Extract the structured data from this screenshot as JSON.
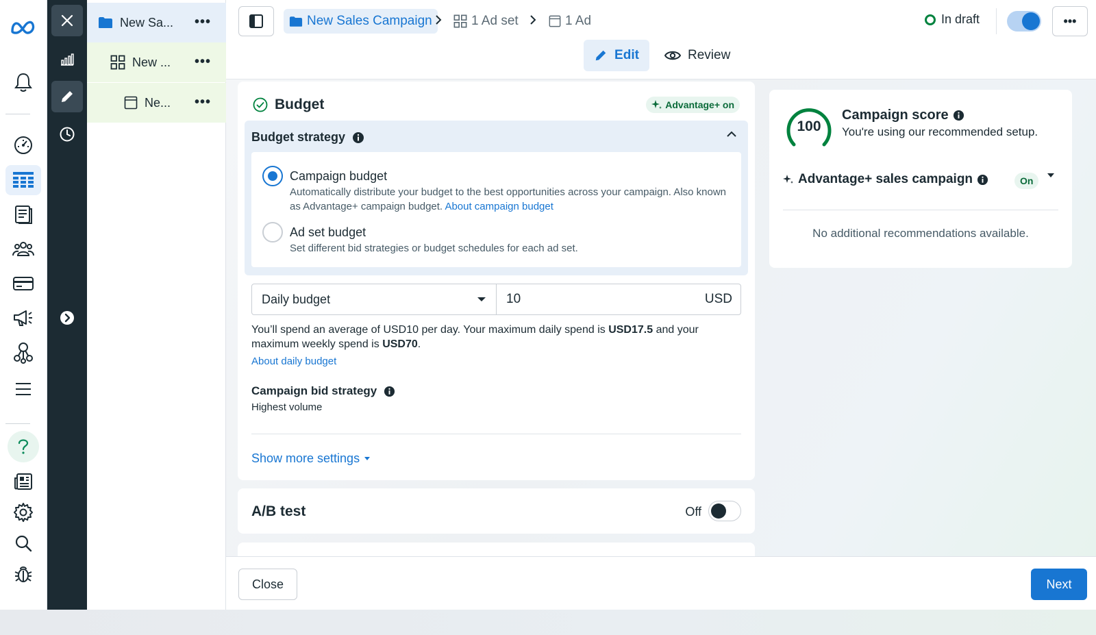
{
  "tree": {
    "campaign_label": "New Sa...",
    "adset_label": "New ...",
    "ad_label": "Ne..."
  },
  "header": {
    "breadcrumb_campaign": "New Sales Campaign",
    "breadcrumb_adset": "1 Ad set",
    "breadcrumb_ad": "1 Ad",
    "status": "In draft",
    "tab_edit": "Edit",
    "tab_review": "Review"
  },
  "budget": {
    "title": "Budget",
    "advantage_badge": "Advantage+ on",
    "strategy_title": "Budget strategy",
    "option_campaign_title": "Campaign budget",
    "option_campaign_desc": "Automatically distribute your budget to the best opportunities across your campaign. Also known as Advantage+ campaign budget.",
    "option_campaign_link": "About campaign budget",
    "option_adset_title": "Ad set budget",
    "option_adset_desc": "Set different bid strategies or budget schedules for each ad set.",
    "budget_type": "Daily budget",
    "amount": "10",
    "currency": "USD",
    "spend_text_1": "You’ll spend an average of USD10 per day. Your maximum daily spend is",
    "spend_max_daily": "USD17.5",
    "spend_text_2": "and your maximum weekly spend is",
    "spend_max_weekly": "USD70",
    "spend_text_3": ".",
    "about_daily_link": "About daily budget",
    "bid_title": "Campaign bid strategy",
    "bid_value": "Highest volume",
    "show_more": "Show more settings"
  },
  "ab_test": {
    "title": "A/B test",
    "state": "Off"
  },
  "score": {
    "value": "100",
    "title": "Campaign score",
    "subtitle": "You're using our recommended setup.",
    "advantage_label": "Advantage+ sales campaign",
    "advantage_state": "On",
    "no_recs": "No additional recommendations available."
  },
  "footer": {
    "close": "Close",
    "next": "Next"
  },
  "colors": {
    "accent": "#1876d2",
    "success": "#00823e",
    "dark": "#1c2b33"
  }
}
